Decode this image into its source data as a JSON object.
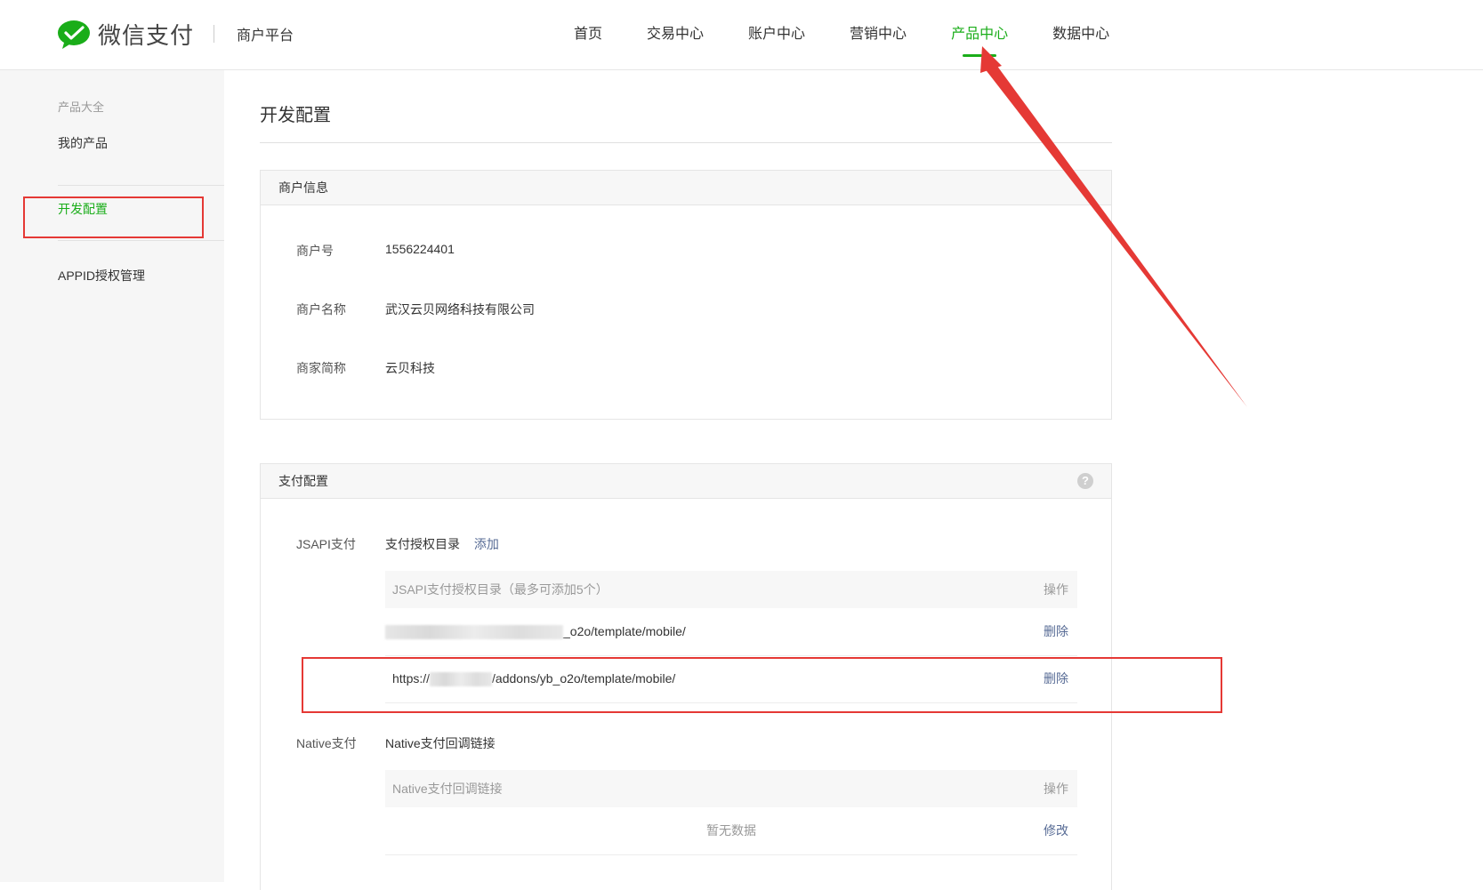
{
  "header": {
    "logo_text": "微信支付",
    "platform": "商户平台",
    "nav": [
      {
        "label": "首页"
      },
      {
        "label": "交易中心"
      },
      {
        "label": "账户中心"
      },
      {
        "label": "营销中心"
      },
      {
        "label": "产品中心",
        "active": true
      },
      {
        "label": "数据中心"
      }
    ]
  },
  "sidebar": {
    "group": "产品大全",
    "my_products": "我的产品",
    "dev_config": "开发配置",
    "appid_mgmt": "APPID授权管理"
  },
  "main": {
    "title": "开发配置",
    "merchant_info": {
      "header": "商户信息",
      "rows": [
        {
          "label": "商户号",
          "value": "1556224401"
        },
        {
          "label": "商户名称",
          "value": "武汉云贝网络科技有限公司"
        },
        {
          "label": "商家简称",
          "value": "云贝科技"
        }
      ]
    },
    "pay_config": {
      "header": "支付配置",
      "help": "?",
      "jsapi": {
        "label": "JSAPI支付",
        "sub_label": "支付授权目录",
        "add_link": "添加",
        "table_header": "JSAPI支付授权目录（最多可添加5个）",
        "action_header": "操作",
        "rows": [
          {
            "prefix": "",
            "suffix": "_o2o/template/mobile/",
            "action": "删除"
          },
          {
            "prefix": "https://",
            "suffix": "/addons/yb_o2o/template/mobile/",
            "action": "删除"
          }
        ]
      },
      "native": {
        "label": "Native支付",
        "sub_label": "Native支付回调链接",
        "table_header": "Native支付回调链接",
        "action_header": "操作",
        "empty": "暂无数据",
        "action": "修改"
      }
    }
  },
  "colors": {
    "accent": "#1aad19",
    "link": "#576b95",
    "annotation": "#e53935"
  }
}
